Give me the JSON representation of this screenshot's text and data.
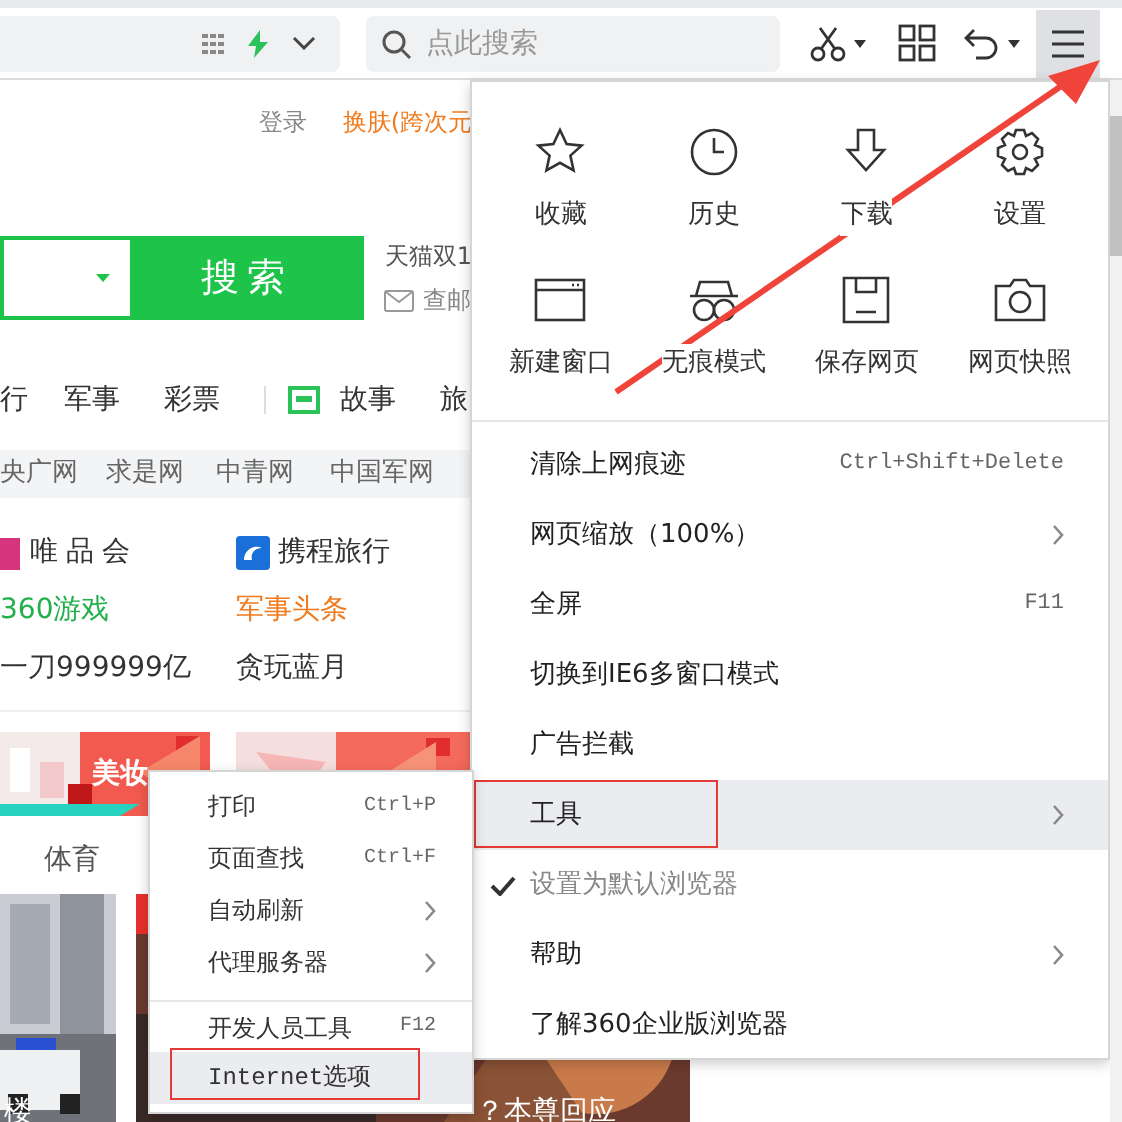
{
  "toolbar": {
    "search": {
      "placeholder": "点此搜索"
    },
    "menu_button": {
      "pressed": true
    }
  },
  "page": {
    "login_link": "登录",
    "skin_link": "换肤(跨次元",
    "search": {
      "button": "搜索"
    },
    "side_links": [
      "天猫双1",
      "查邮"
    ],
    "nav": [
      "行",
      "军事",
      "彩票",
      "故事",
      "旅"
    ],
    "media_links": [
      "央广网",
      "求是网",
      "中青网",
      "中国军网"
    ],
    "site_links": [
      {
        "label": "唯品会",
        "color": "#333333"
      },
      {
        "label": "携程旅行",
        "color": "#333333"
      },
      {
        "label": "360游戏",
        "color": "#22b04a"
      },
      {
        "label": "军事头条",
        "color": "#f07b1e"
      },
      {
        "label": "一刀999999亿",
        "color": "#333333"
      },
      {
        "label": "贪玩蓝月",
        "color": "#333333"
      }
    ],
    "banner": {
      "label": "美妆"
    },
    "tab": "体育",
    "news": [
      {
        "caption": "楼"
      },
      {
        "caption": "？本尊回应"
      }
    ]
  },
  "main_menu": {
    "grid": [
      "收藏",
      "历史",
      "下载",
      "设置",
      "新建窗口",
      "无痕模式",
      "保存网页",
      "网页快照"
    ],
    "items": [
      {
        "label": "清除上网痕迹",
        "shortcut": "Ctrl+Shift+Delete",
        "submenu": false,
        "highlighted": false,
        "outlined": false,
        "checked": false,
        "disabled": false
      },
      {
        "label": "网页缩放（100%）",
        "submenu": true,
        "highlighted": false,
        "outlined": false,
        "checked": false,
        "disabled": false
      },
      {
        "label": "全屏",
        "shortcut": "F11",
        "submenu": false,
        "highlighted": false,
        "outlined": false,
        "checked": false,
        "disabled": false
      },
      {
        "label": "切换到IE6多窗口模式",
        "submenu": false,
        "highlighted": false,
        "outlined": false,
        "checked": false,
        "disabled": false
      },
      {
        "label": "广告拦截",
        "submenu": false,
        "highlighted": false,
        "outlined": false,
        "checked": false,
        "disabled": false
      },
      {
        "label": "工具",
        "submenu": true,
        "highlighted": true,
        "outlined": true,
        "checked": false,
        "disabled": false
      },
      {
        "label": "设置为默认浏览器",
        "submenu": false,
        "highlighted": false,
        "outlined": false,
        "checked": true,
        "disabled": true
      },
      {
        "label": "帮助",
        "submenu": true,
        "highlighted": false,
        "outlined": false,
        "checked": false,
        "disabled": false
      },
      {
        "label": "了解360企业版浏览器",
        "submenu": false,
        "highlighted": false,
        "outlined": false,
        "checked": false,
        "disabled": false
      }
    ]
  },
  "tools_menu": {
    "items": [
      {
        "label": "打印",
        "shortcut": "Ctrl+P",
        "submenu": false,
        "separator_before": false,
        "highlighted": false,
        "outlined": false
      },
      {
        "label": "页面查找",
        "shortcut": "Ctrl+F",
        "submenu": false,
        "separator_before": false,
        "highlighted": false,
        "outlined": false
      },
      {
        "label": "自动刷新",
        "submenu": true,
        "separator_before": false,
        "highlighted": false,
        "outlined": false
      },
      {
        "label": "代理服务器",
        "submenu": true,
        "separator_before": false,
        "highlighted": false,
        "outlined": false
      },
      {
        "label": "开发人员工具",
        "shortcut": "F12",
        "submenu": false,
        "separator_before": true,
        "highlighted": false,
        "outlined": false
      },
      {
        "label": "Internet选项",
        "submenu": false,
        "separator_before": false,
        "highlighted": true,
        "outlined": true
      }
    ]
  }
}
